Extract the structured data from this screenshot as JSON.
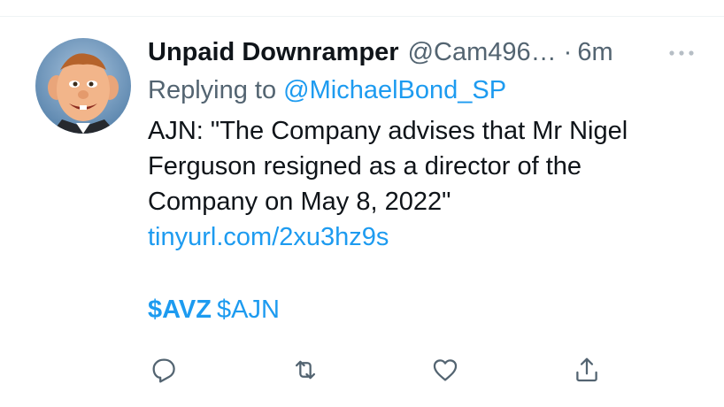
{
  "tweet": {
    "display_name": "Unpaid Downramper",
    "handle": "@Cam496…",
    "separator": "·",
    "timestamp": "6m",
    "replying_prefix": "Replying to",
    "replying_to": "@MichaelBond_SP",
    "body": "AJN: \"The Company advises that Mr Nigel\nFerguson resigned as a director of the\nCompany on May 8, 2022\"",
    "link": "tinyurl.com/2xu3hz9s",
    "cashtag_primary": "$AVZ",
    "cashtag_secondary": "$AJN"
  },
  "icons": {
    "more": "more-horizontal-icon",
    "reply": "reply-icon",
    "retweet": "retweet-icon",
    "like": "heart-icon",
    "share": "share-icon"
  },
  "colors": {
    "accent": "#1d9bf0",
    "text": "#0f1419",
    "secondary_text": "#536471",
    "divider": "#eff3f4"
  }
}
